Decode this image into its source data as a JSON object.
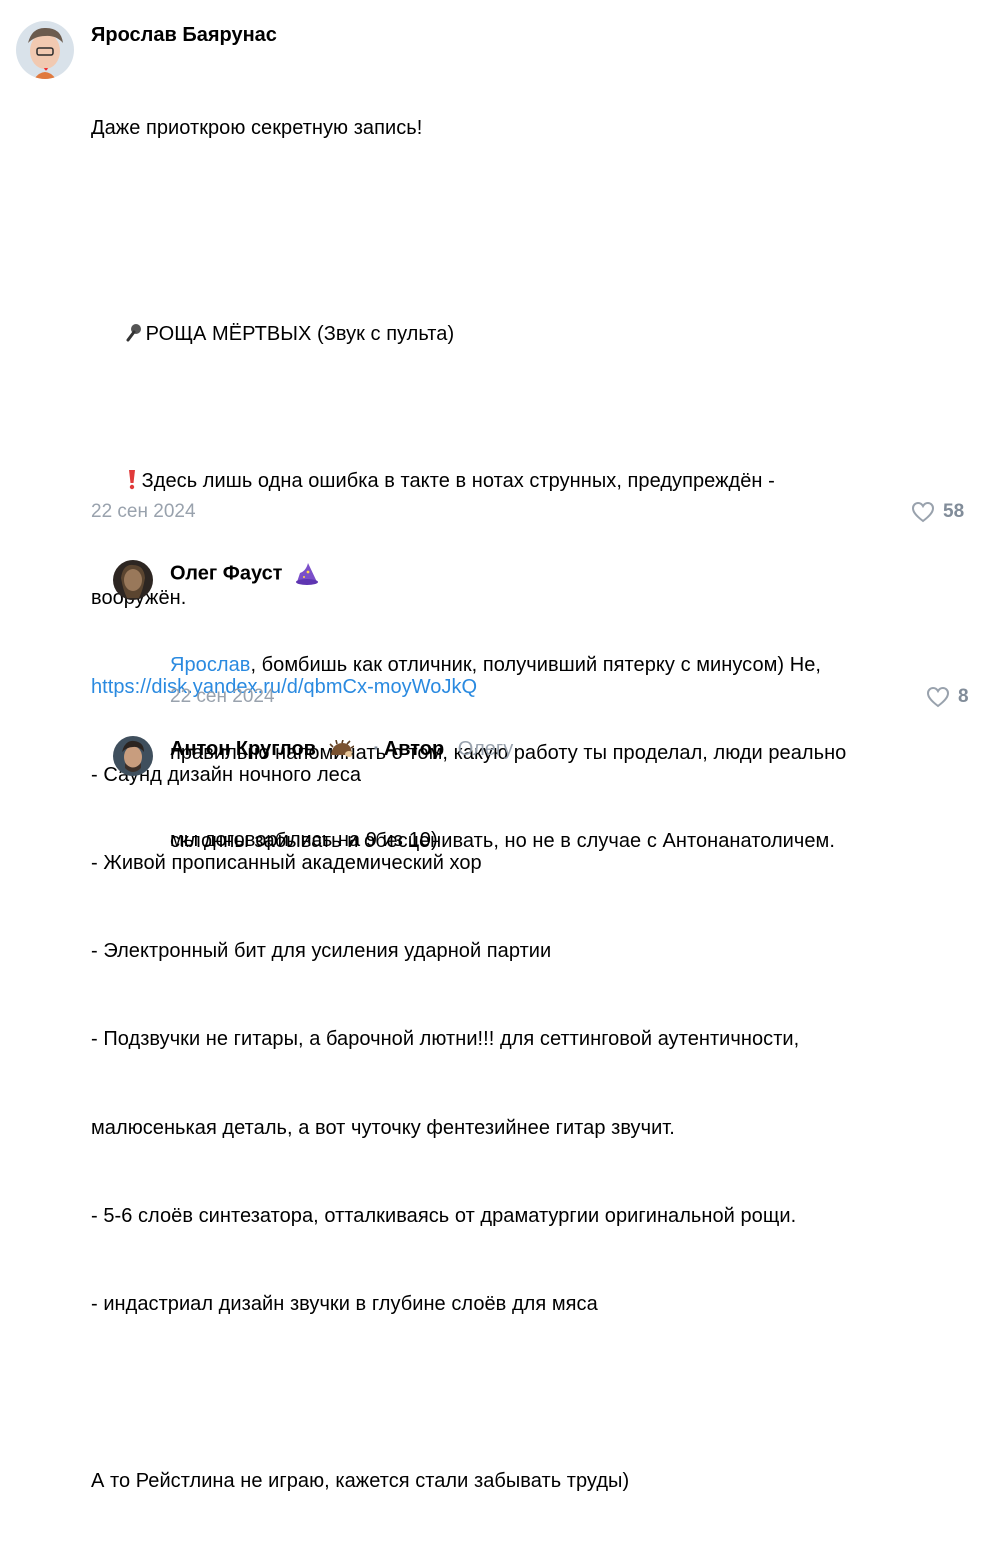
{
  "comments": [
    {
      "author": "Ярослав Баярунас",
      "lines": [
        "Даже приоткрою секретную запись!",
        "",
        "РОЩА МЁРТВЫХ (Звук с пульта)",
        "Здесь лишь одна ошибка в такте в нотах струнных, предупреждён -",
        "вооружён.",
        "https://disk.yandex.ru/d/qbmCx-moyWoJkQ",
        "- Саунд дизайн ночного леса",
        "- Живой прописанный академический хор",
        "- Электронный бит для усиления ударной партии",
        "- Подзвучки не гитары, а барочной лютни!!! для сеттинговой аутентичности,",
        "малюсенькая деталь, а вот чуточку фентезийнее гитар звучит.",
        "- 5-6 слоёв синтезатора, отталкиваясь от драматургии оригинальной рощи.",
        "- индастриал дизайн звучки в глубине слоёв для мяса",
        "",
        "А то Рейстлина не играю, кажется стали забывать труды)"
      ],
      "date": "22 сен 2024",
      "likes": "58"
    },
    {
      "author": "Олег Фауст",
      "mention": "Ярослав",
      "lines": [
        ", бомбишь как отличник, получивший пятерку с минусом) Не,",
        "правильно напоминать о том, какую работу ты проделал, люди реально",
        "склонны забывать и обесценивать, но не в случае с Антонанатоличем."
      ],
      "date": "22 сен 2024",
      "likes": "8"
    },
    {
      "author": "Антон Круглов",
      "role": "Автор",
      "reply_to": "Олегу",
      "lines": [
        "мы договорились на 9 из 10)"
      ]
    }
  ],
  "icons": {
    "microphone": "microphone-icon",
    "exclamation": "exclamation-icon",
    "heart": "heart-icon",
    "wizard": "wizard-hat-icon",
    "hedgehog": "hedgehog-icon"
  },
  "colors": {
    "link": "#2a8ae0",
    "muted": "#99a2ad",
    "exclamation": "#e03a3a"
  }
}
